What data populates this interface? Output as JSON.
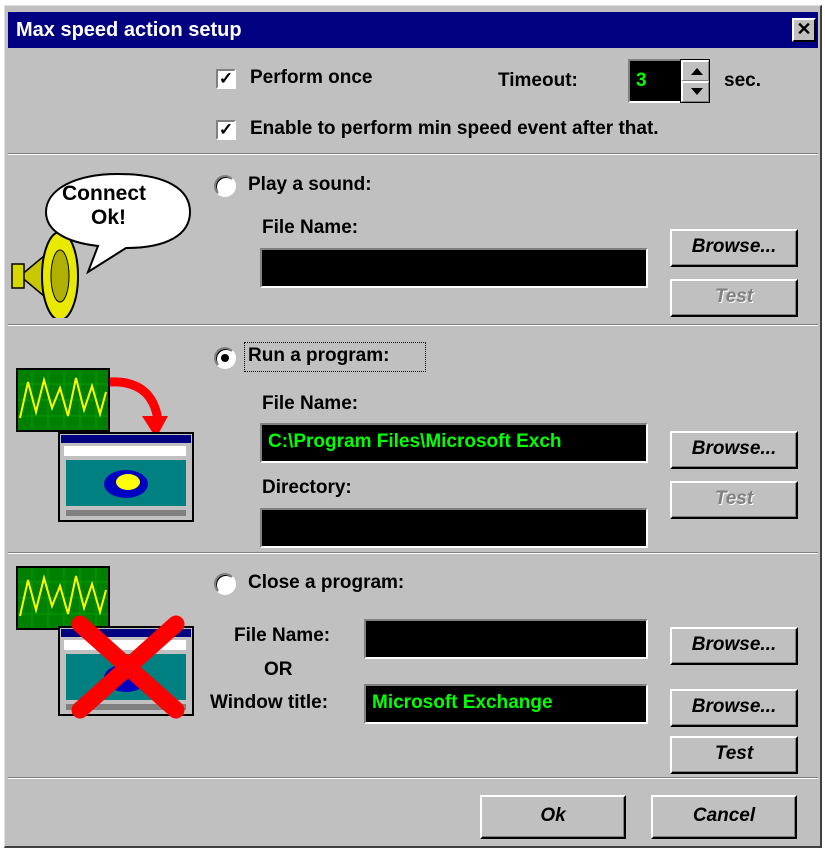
{
  "window": {
    "title": "Max speed action setup",
    "close_glyph": "✕"
  },
  "top": {
    "perform_once": {
      "label": "Perform once",
      "checked": true
    },
    "timeout": {
      "label": "Timeout:",
      "value": "3",
      "unit": "sec."
    },
    "enable_min": {
      "label": "Enable to perform min speed event after that.",
      "checked": true
    }
  },
  "sound": {
    "bubble_line1": "Connect",
    "bubble_line2": "Ok!",
    "radio_label": "Play a sound:",
    "selected": false,
    "file_label": "File Name:",
    "file_value": "",
    "browse": "Browse...",
    "test": "Test"
  },
  "run": {
    "radio_label": "Run a program:",
    "selected": true,
    "file_label": "File Name:",
    "file_value": "C:\\Program Files\\Microsoft Exch",
    "dir_label": "Directory:",
    "dir_value": "",
    "browse": "Browse...",
    "test": "Test"
  },
  "close": {
    "radio_label": "Close a program:",
    "selected": false,
    "file_label": "File Name:",
    "file_value": "",
    "or_label": "OR",
    "window_label": "Window title:",
    "window_value": "Microsoft Exchange",
    "browse1": "Browse...",
    "browse2": "Browse...",
    "test": "Test"
  },
  "footer": {
    "ok": "Ok",
    "cancel": "Cancel"
  },
  "colors": {
    "face": "#c0c0c0",
    "title": "#000080",
    "field_bg": "#000000",
    "field_text": "#00ff00"
  },
  "icons": [
    "speaker-icon",
    "speech-bubble-icon",
    "oscilloscope-icon",
    "program-window-icon",
    "red-x-icon"
  ]
}
